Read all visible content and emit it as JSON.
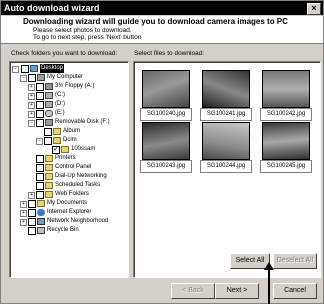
{
  "window": {
    "title": "Auto download wizard",
    "close_label": "×"
  },
  "header": {
    "headline": "Downloading wizard will guide you to download camera images to PC",
    "line1": "Please select photos to download.",
    "line2": "To go to next step, press 'Next' button"
  },
  "left_panel": {
    "label": "Check folders you want to download:"
  },
  "right_panel": {
    "label": "Select files to download:"
  },
  "tree": [
    {
      "label": "Desktop",
      "selected": true
    },
    {
      "label": "My Computer"
    },
    {
      "label": "3½ Floppy (A:)"
    },
    {
      "label": "(C:)"
    },
    {
      "label": "(D:)"
    },
    {
      "label": "(E:)"
    },
    {
      "label": "Removable Disk (F:)"
    },
    {
      "label": "Album"
    },
    {
      "label": "Dcim"
    },
    {
      "label": "100ssam",
      "checked": true
    },
    {
      "label": "Printers"
    },
    {
      "label": "Control Panel"
    },
    {
      "label": "Dial-Up Networking"
    },
    {
      "label": "Scheduled Tasks"
    },
    {
      "label": "Web Folders"
    },
    {
      "label": "My Documents"
    },
    {
      "label": "Internet Explorer"
    },
    {
      "label": "Network Neighborhood"
    },
    {
      "label": "Recycle Bin"
    }
  ],
  "files": [
    {
      "name": "SG100240.jpg"
    },
    {
      "name": "SG100241.jpg"
    },
    {
      "name": "SG100242.jpg"
    },
    {
      "name": "SG100243.jpg"
    },
    {
      "name": "SG100244.jpg"
    },
    {
      "name": "SG100245.jpg"
    }
  ],
  "buttons": {
    "select_all": "Select All",
    "deselect_all": "Deselect All",
    "back": "< Back",
    "next": "Next >",
    "cancel": "Cancel"
  }
}
